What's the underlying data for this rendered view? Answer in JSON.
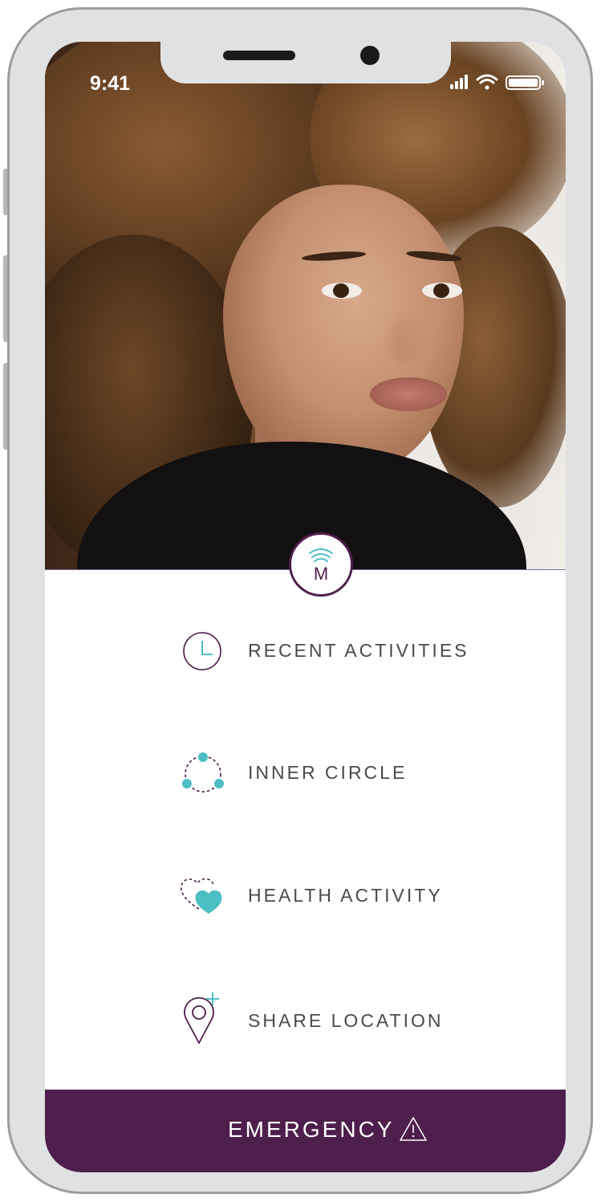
{
  "status_bar": {
    "time": "9:41",
    "icons": [
      "signal-icon",
      "wifi-icon",
      "battery-icon"
    ]
  },
  "hero": {
    "photo": "portrait-photo"
  },
  "logo": {
    "letter": "M",
    "icon": "wireless-signal-icon"
  },
  "menu": {
    "items": [
      {
        "label": "RECENT ACTIVITIES",
        "icon": "clock-icon"
      },
      {
        "label": "INNER CIRCLE",
        "icon": "inner-circle-icon"
      },
      {
        "label": "HEALTH ACTIVITY",
        "icon": "heart-icon"
      },
      {
        "label": "SHARE LOCATION",
        "icon": "location-pin-icon"
      }
    ]
  },
  "emergency": {
    "label": "EMERGENCY",
    "icon": "warning-icon"
  },
  "colors": {
    "brand_purple": "#4e1f4c",
    "accent_teal": "#4bbfc3",
    "frame": "#e0e1e2",
    "label_text": "#4a4a4c"
  }
}
